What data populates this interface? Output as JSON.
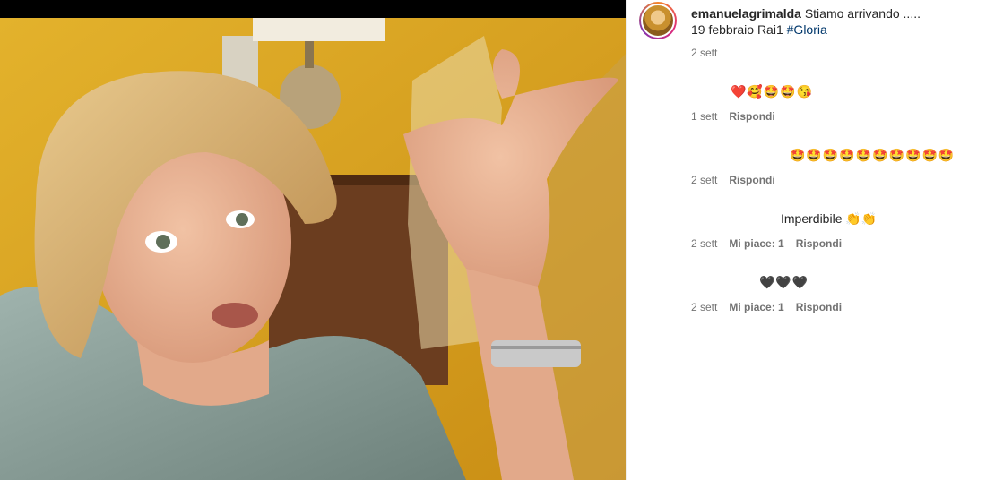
{
  "post": {
    "username": "emanuelagrimalda",
    "caption_line1": "Stiamo arrivando .....",
    "caption_line2": "19 febbraio Rai1",
    "hashtag": "#Gloria",
    "time": "2 sett"
  },
  "comments": [
    {
      "text": "❤️🥰🤩🤩😘",
      "time": "1 sett",
      "likes": "",
      "reply": "Rispondi"
    },
    {
      "text": "🤩🤩🤩🤩🤩🤩🤩🤩🤩🤩",
      "time": "2 sett",
      "likes": "",
      "reply": "Rispondi"
    },
    {
      "text": "Imperdibile 👏👏",
      "time": "2 sett",
      "likes": "Mi piace: 1",
      "reply": "Rispondi"
    },
    {
      "text": "🖤🖤🖤",
      "time": "2 sett",
      "likes": "Mi piace: 1",
      "reply": "Rispondi"
    }
  ],
  "icons": {
    "avatar": "profile-avatar",
    "photo": "selfie-photo"
  },
  "colors": {
    "link": "#00376b",
    "meta": "#737373",
    "photo_background": "#d9a321"
  }
}
